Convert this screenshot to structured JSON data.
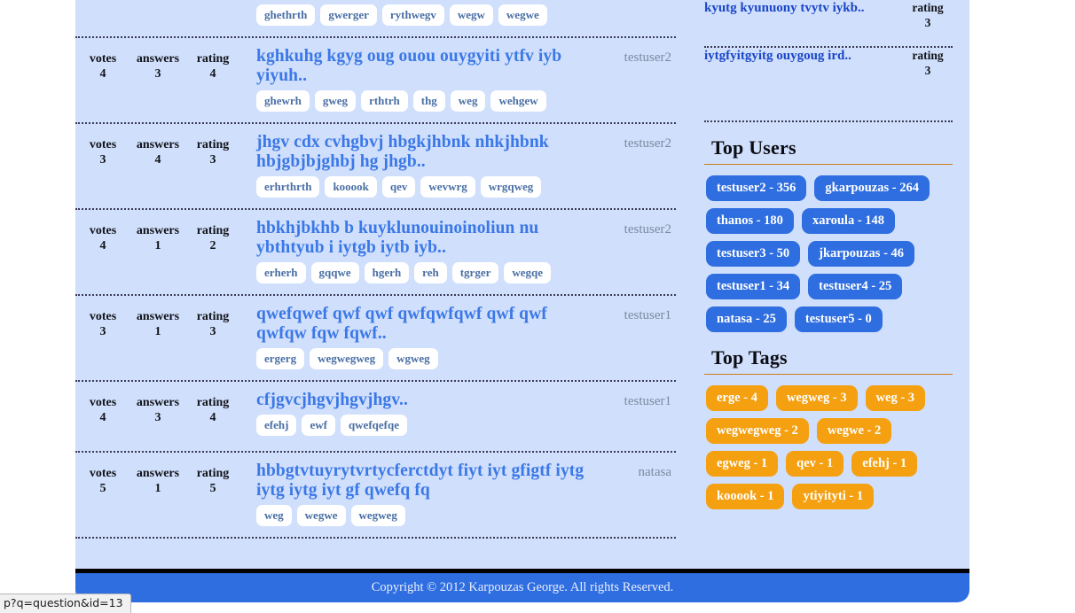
{
  "footer": {
    "copyright": "Copyright © 2012 Karpouzas George. All rights Reserved."
  },
  "status_bar": {
    "url": "p?q=question&id=13"
  },
  "colors": {
    "page_background": "#d0dffb",
    "question_link": "#3b78e7",
    "sidebar_link": "#1a46c8",
    "user_pill": "#2f6ee0",
    "tag_pill": "#f5a011",
    "footer": "#2f6ee0",
    "rule": "#c97c1d"
  },
  "questions": {
    "labels": {
      "votes": "votes",
      "answers": "answers",
      "rating": "rating"
    },
    "rows": [
      {
        "clipped": true,
        "votes": "",
        "answers": "",
        "rating": "",
        "title": "",
        "tags": [
          "ghethrth",
          "gwerger",
          "rythwegv",
          "wegw",
          "wegwe"
        ],
        "user": ""
      },
      {
        "clipped": false,
        "votes": "4",
        "answers": "3",
        "rating": "4",
        "title": "kghkuhg kgyg oug ouou ouygyiti ytfv iyb yiyuh..",
        "tags": [
          "ghewrh",
          "gweg",
          "rthtrh",
          "thg",
          "weg",
          "wehgew"
        ],
        "user": "testuser2"
      },
      {
        "clipped": false,
        "votes": "3",
        "answers": "4",
        "rating": "3",
        "title": "jhgv cdx cvhgbvj hbgkjhbnk nhkjhbnk hbjgbjbjghbj hg jhgb..",
        "tags": [
          "erhrthrth",
          "kooook",
          "qev",
          "wevwrg",
          "wrgqweg"
        ],
        "user": "testuser2"
      },
      {
        "clipped": false,
        "votes": "4",
        "answers": "1",
        "rating": "2",
        "title": "hbkhjbkhb b kuyklunouinoinoliun nu ybthtyub i iytgb iytb iyb..",
        "tags": [
          "erherh",
          "gqqwe",
          "hgerh",
          "reh",
          "tgrger",
          "wegqe"
        ],
        "user": "testuser2"
      },
      {
        "clipped": false,
        "votes": "3",
        "answers": "1",
        "rating": "3",
        "title": "qwefqwef qwf qwf qwfqwfqwf qwf qwf qwfqw fqw fqwf..",
        "tags": [
          "ergerg",
          "wegwegweg",
          "wgweg"
        ],
        "user": "testuser1"
      },
      {
        "clipped": false,
        "votes": "4",
        "answers": "3",
        "rating": "4",
        "title": "cfjgvcjhgvjhgvjhgv..",
        "tags": [
          "efehj",
          "ewf",
          "qwefqefqe"
        ],
        "user": "testuser1"
      },
      {
        "clipped": false,
        "votes": "5",
        "answers": "1",
        "rating": "5",
        "title": "hbbgtvtuyrytvrtycferctdyt fiyt iyt gfigtf iytg iytg iytg iyt gf qwefq fq",
        "tags": [
          "weg",
          "wegwe",
          "wegweg"
        ],
        "user": "natasa"
      }
    ]
  },
  "sidebar": {
    "rating_label": "rating",
    "top_questions": [
      {
        "title": "kyutg kyunuony tvytv iykb..",
        "rating": "3"
      },
      {
        "title": "iytgfyitgyitg ouygoug ird..",
        "rating": "3"
      }
    ],
    "top_users_heading": "Top Users",
    "top_users": [
      "testuser2 - 356",
      "gkarpouzas - 264",
      "thanos - 180",
      "xaroula - 148",
      "testuser3 - 50",
      "jkarpouzas - 46",
      "testuser1 - 34",
      "testuser4 - 25",
      "natasa - 25",
      "testuser5 - 0"
    ],
    "top_tags_heading": "Top Tags",
    "top_tags": [
      "erge - 4",
      "wegweg - 3",
      "weg - 3",
      "wegwegweg - 2",
      "wegwe - 2",
      "egweg - 1",
      "qev - 1",
      "efehj - 1",
      "kooook - 1",
      "ytiyityti - 1"
    ]
  }
}
